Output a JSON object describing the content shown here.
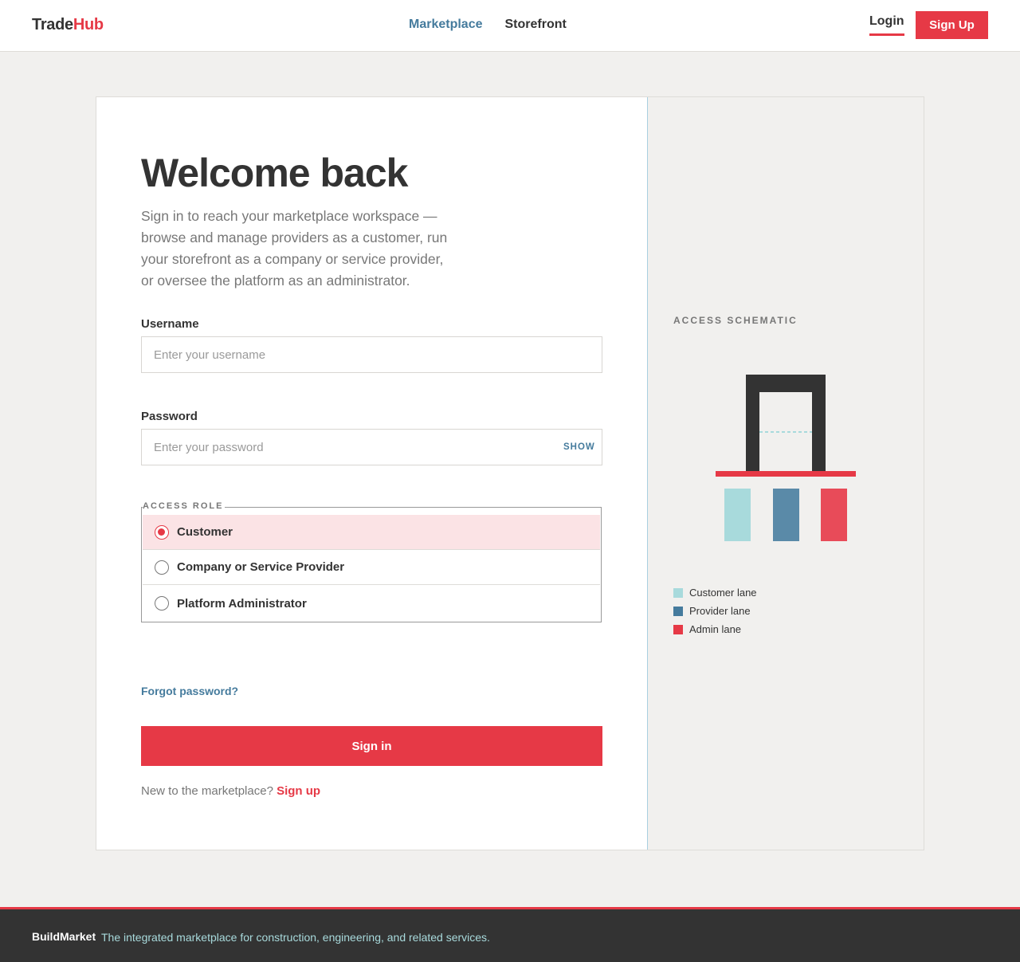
{
  "header": {
    "logo_part1": "Trade",
    "logo_part2": "Hub",
    "nav": [
      "Marketplace",
      "Storefront"
    ],
    "login": "Login",
    "signup": "Sign Up"
  },
  "login_form": {
    "title": "Welcome back",
    "subtitle": "Sign in to reach your marketplace workspace — browse and manage providers as a customer, run your storefront as a company or service provider, or oversee the platform as an administrator.",
    "username_label": "Username",
    "username_placeholder": "Enter your username",
    "username_value": "",
    "password_label": "Password",
    "password_placeholder": "Enter your password",
    "password_value": "",
    "show_label": "SHOW",
    "role_legend": "ACCESS ROLE",
    "roles": [
      {
        "label": "Customer",
        "selected": true
      },
      {
        "label": "Company or Service Provider",
        "selected": false
      },
      {
        "label": "Platform Administrator",
        "selected": false
      }
    ],
    "forgot": "Forgot password?",
    "submit": "Sign in",
    "new_prompt": "New to the marketplace?",
    "new_link": "Sign up"
  },
  "schematic": {
    "title": "ACCESS SCHEMATIC",
    "legend": [
      {
        "label": "Customer lane",
        "color": "#a8dadc"
      },
      {
        "label": "Provider lane",
        "color": "#457b9d"
      },
      {
        "label": "Admin lane",
        "color": "#e63946"
      }
    ]
  },
  "footer": {
    "brand": "BuildMarket",
    "tagline": "The integrated marketplace for construction, engineering, and related services."
  },
  "colors": {
    "accent": "#e63946",
    "link": "#457b9d",
    "dark": "#333333",
    "light_teal": "#a8dadc"
  }
}
